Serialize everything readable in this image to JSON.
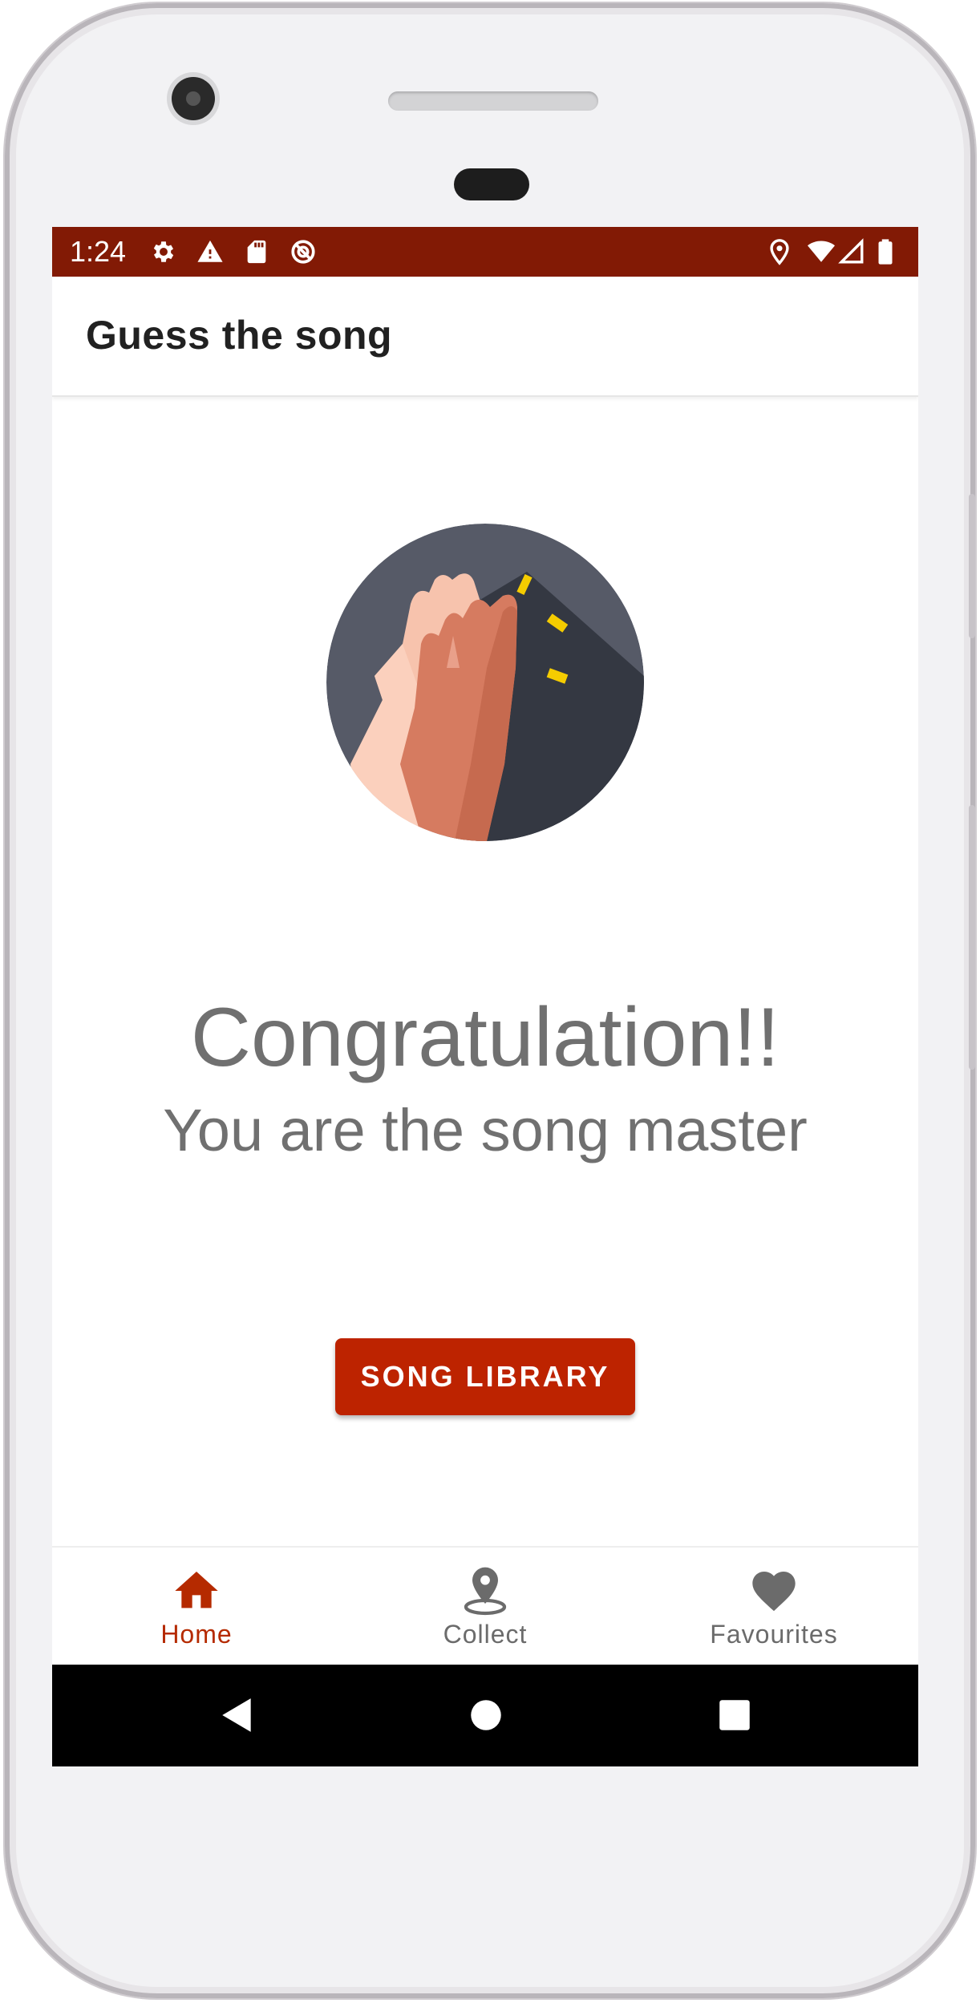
{
  "status_bar": {
    "time": "1:24",
    "left_icons": [
      "gear-icon",
      "warning-icon",
      "sd-card-icon",
      "sync-off-icon"
    ],
    "right_icons": [
      "location-pin-icon",
      "wifi-icon",
      "signal-icon",
      "battery-icon"
    ],
    "background": "#821a05"
  },
  "app_bar": {
    "title": "Guess the song"
  },
  "main": {
    "illustration": "high-five-hands-icon",
    "heading": "Congratulation!!",
    "subheading": "You are the song master",
    "button_label": "SONG LIBRARY",
    "button_color": "#bd2300"
  },
  "bottom_nav": {
    "items": [
      {
        "label": "Home",
        "icon": "home-icon",
        "active": true
      },
      {
        "label": "Collect",
        "icon": "map-pin-icon",
        "active": false
      },
      {
        "label": "Favourites",
        "icon": "heart-icon",
        "active": false
      }
    ],
    "active_color": "#b52a00",
    "inactive_color": "#6b6b6b"
  },
  "system_nav": {
    "buttons": [
      "back-icon",
      "home-circle-icon",
      "recents-icon"
    ]
  }
}
